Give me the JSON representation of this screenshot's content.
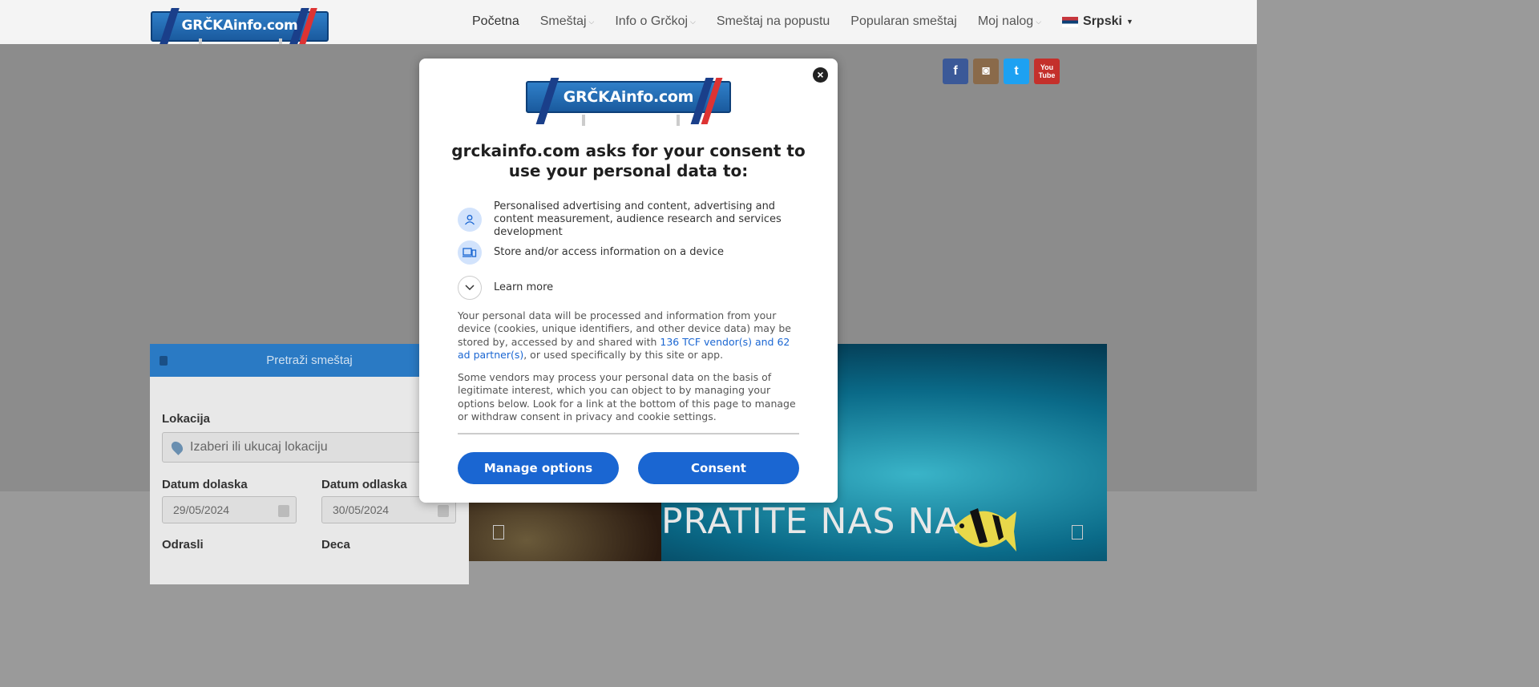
{
  "site": {
    "logo_text": "GRČKAinfo.com"
  },
  "nav": {
    "items": [
      {
        "label": "Početna",
        "dropdown": false,
        "active": true
      },
      {
        "label": "Smeštaj",
        "dropdown": true
      },
      {
        "label": "Info o Grčkoj",
        "dropdown": true
      },
      {
        "label": "Smeštaj na popustu",
        "dropdown": false
      },
      {
        "label": "Popularan smeštaj",
        "dropdown": false
      },
      {
        "label": "Moj nalog",
        "dropdown": true
      }
    ],
    "language": "Srpski"
  },
  "social": [
    {
      "name": "facebook-icon",
      "glyph": "f",
      "color": "#3b5998"
    },
    {
      "name": "instagram-icon",
      "glyph": "◙",
      "color": "#8a6a4a"
    },
    {
      "name": "twitter-icon",
      "glyph": "t",
      "color": "#1da1f2"
    },
    {
      "name": "youtube-icon",
      "glyph": "You Tube",
      "color": "#c4302b"
    }
  ],
  "search": {
    "header": "Pretraži smeštaj",
    "location_label": "Lokacija",
    "location_placeholder": "Izaberi ili ukucaj lokaciju",
    "arrival_label": "Datum dolaska",
    "arrival_value": "29/05/2024",
    "departure_label": "Datum odlaska",
    "departure_value": "30/05/2024",
    "adults_label": "Odrasli",
    "children_label": "Deca"
  },
  "banner": {
    "text": "PRATITE NAS NA"
  },
  "consent": {
    "title": "grckainfo.com asks for your consent to use your personal data to:",
    "purposes": [
      {
        "icon": "person-icon",
        "text": "Personalised advertising and content, advertising and content measurement, audience research and services development"
      },
      {
        "icon": "devices-icon",
        "text": "Store and/or access information on a device"
      }
    ],
    "learn_more": "Learn more",
    "para1_before": "Your personal data will be processed and information from your device (cookies, unique identifiers, and other device data) may be stored by, accessed by and shared with ",
    "para1_link": "136 TCF vendor(s) and 62 ad partner(s)",
    "para1_after": ", or used specifically by this site or app.",
    "para2": "Some vendors may process your personal data on the basis of legitimate interest, which you can object to by managing your options below. Look for a link at the bottom of this page to manage or withdraw consent in privacy and cookie settings.",
    "manage_button": "Manage options",
    "consent_button": "Consent",
    "close_glyph": "×"
  },
  "colors": {
    "accent": "#1a66d2",
    "icon_bg": "#d2e3fc"
  }
}
